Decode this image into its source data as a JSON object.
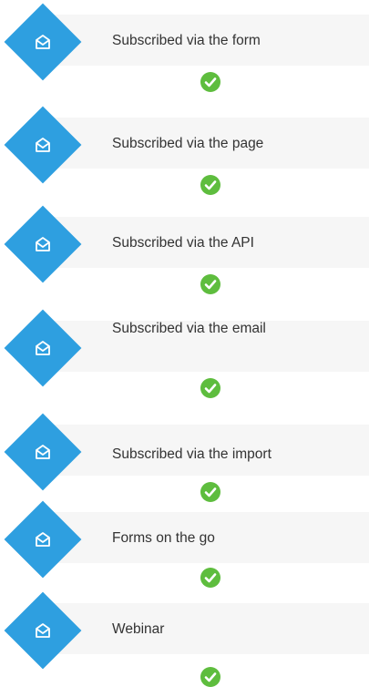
{
  "brand_color": "#2e9fe0",
  "check_color": "#5ebd3e",
  "panel_color": "#f6f6f6",
  "items": [
    {
      "label": "Subscribed via the form",
      "icon": "envelope-open-icon",
      "status": "check-icon"
    },
    {
      "label": "Subscribed via the page",
      "icon": "envelope-open-icon",
      "status": "check-icon"
    },
    {
      "label": "Subscribed via the API",
      "icon": "envelope-open-icon",
      "status": "check-icon"
    },
    {
      "label": "Subscribed via the email",
      "icon": "envelope-open-icon",
      "status": "check-icon"
    },
    {
      "label": "Subscribed via the import",
      "icon": "envelope-open-icon",
      "status": "check-icon"
    },
    {
      "label": "Forms on the go",
      "icon": "envelope-open-icon",
      "status": "check-icon"
    },
    {
      "label": "Webinar",
      "icon": "envelope-open-icon",
      "status": "check-icon"
    }
  ]
}
